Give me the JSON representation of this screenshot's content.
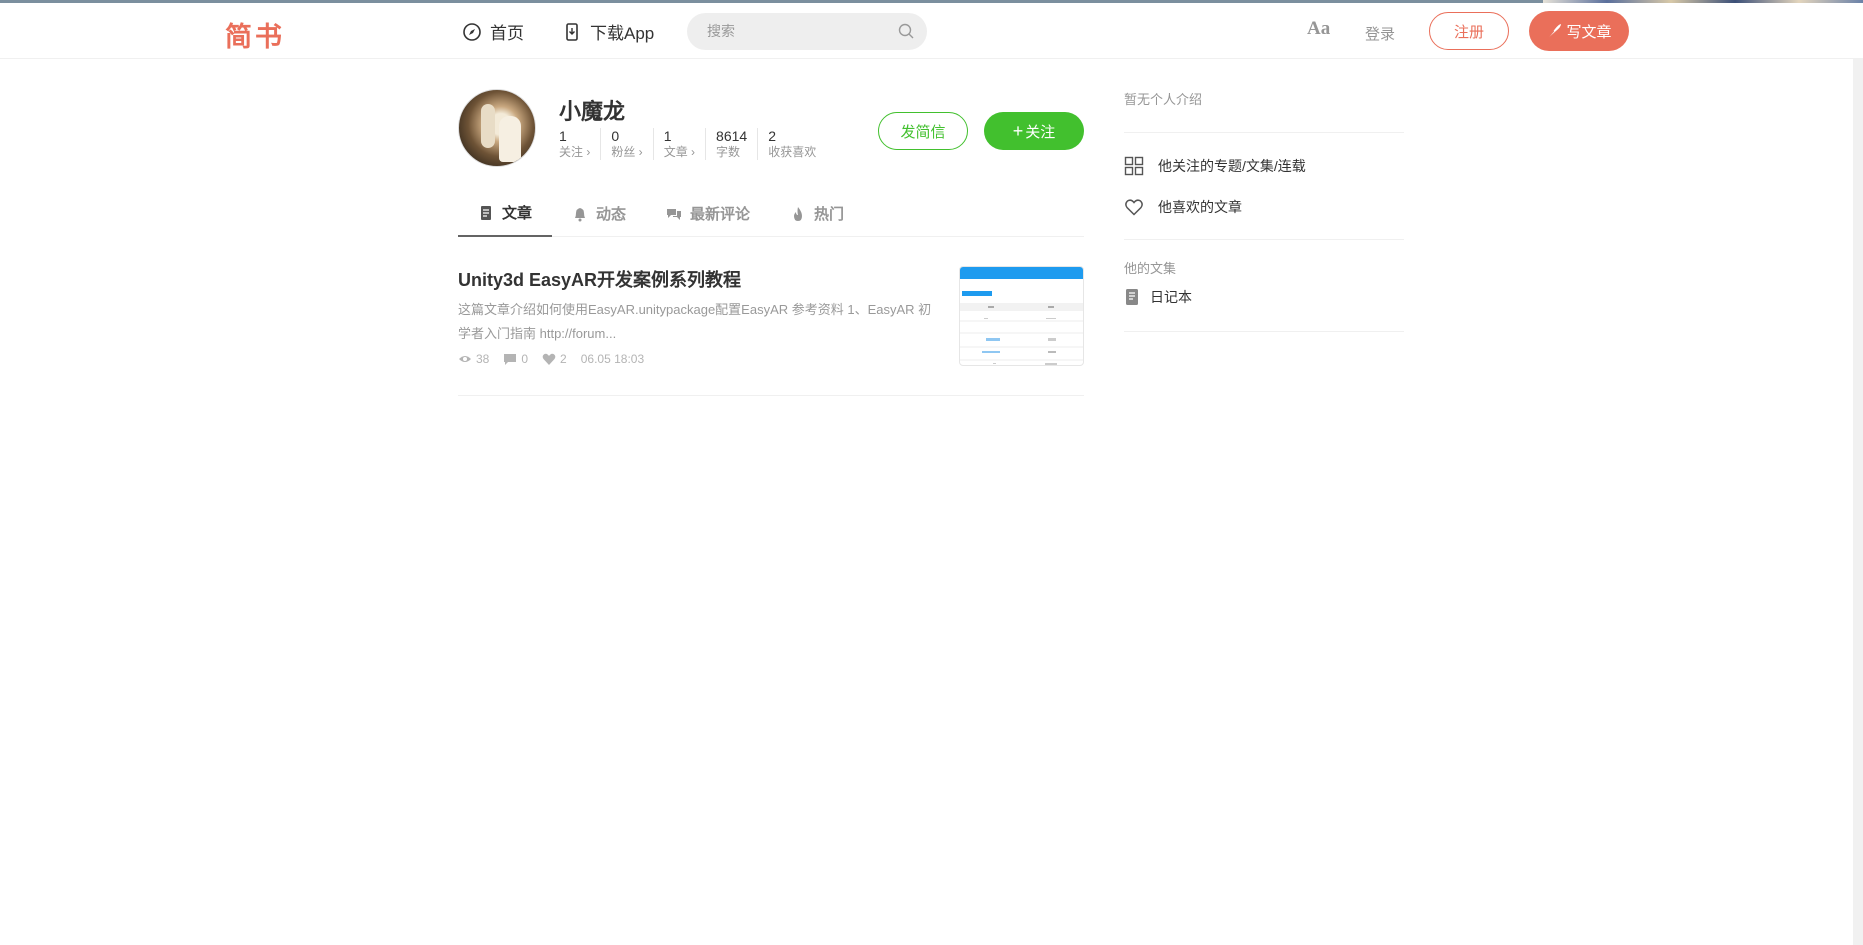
{
  "header": {
    "logo": "简书",
    "nav": [
      {
        "label": "首页",
        "icon": "compass-icon"
      },
      {
        "label": "下载App",
        "icon": "phone-download-icon"
      }
    ],
    "search_placeholder": "搜索",
    "font_toggle": "Aa",
    "login": "登录",
    "signup": "注册",
    "write": "写文章"
  },
  "profile": {
    "name": "小魔龙",
    "stats": [
      {
        "num": "1",
        "label": "关注 ›"
      },
      {
        "num": "0",
        "label": "粉丝 ›"
      },
      {
        "num": "1",
        "label": "文章 ›"
      },
      {
        "num": "8614",
        "label": "字数"
      },
      {
        "num": "2",
        "label": "收获喜欢"
      }
    ],
    "message_button": "发简信",
    "follow_button": "关注"
  },
  "tabs": [
    {
      "label": "文章",
      "active": true
    },
    {
      "label": "动态",
      "active": false
    },
    {
      "label": "最新评论",
      "active": false
    },
    {
      "label": "热门",
      "active": false
    }
  ],
  "article": {
    "title": "Unity3d EasyAR开发案例系列教程",
    "abstract": "这篇文章介绍如何使用EasyAR.unitypackage配置EasyAR 参考资料 1、EasyAR 初学者入门指南 http://forum...",
    "views": "38",
    "comments": "0",
    "likes": "2",
    "time": "06.05 18:03"
  },
  "aside": {
    "intro": "暂无个人介绍",
    "links": [
      {
        "label": "他关注的专题/文集/连载",
        "icon": "grid-icon"
      },
      {
        "label": "他喜欢的文章",
        "icon": "heart-icon"
      }
    ],
    "collections_title": "他的文集",
    "collections": [
      {
        "label": "日记本",
        "icon": "notebook-icon"
      }
    ]
  },
  "colors": {
    "brand": "#ea6f5a",
    "green": "#42c02e",
    "muted": "#969696"
  }
}
